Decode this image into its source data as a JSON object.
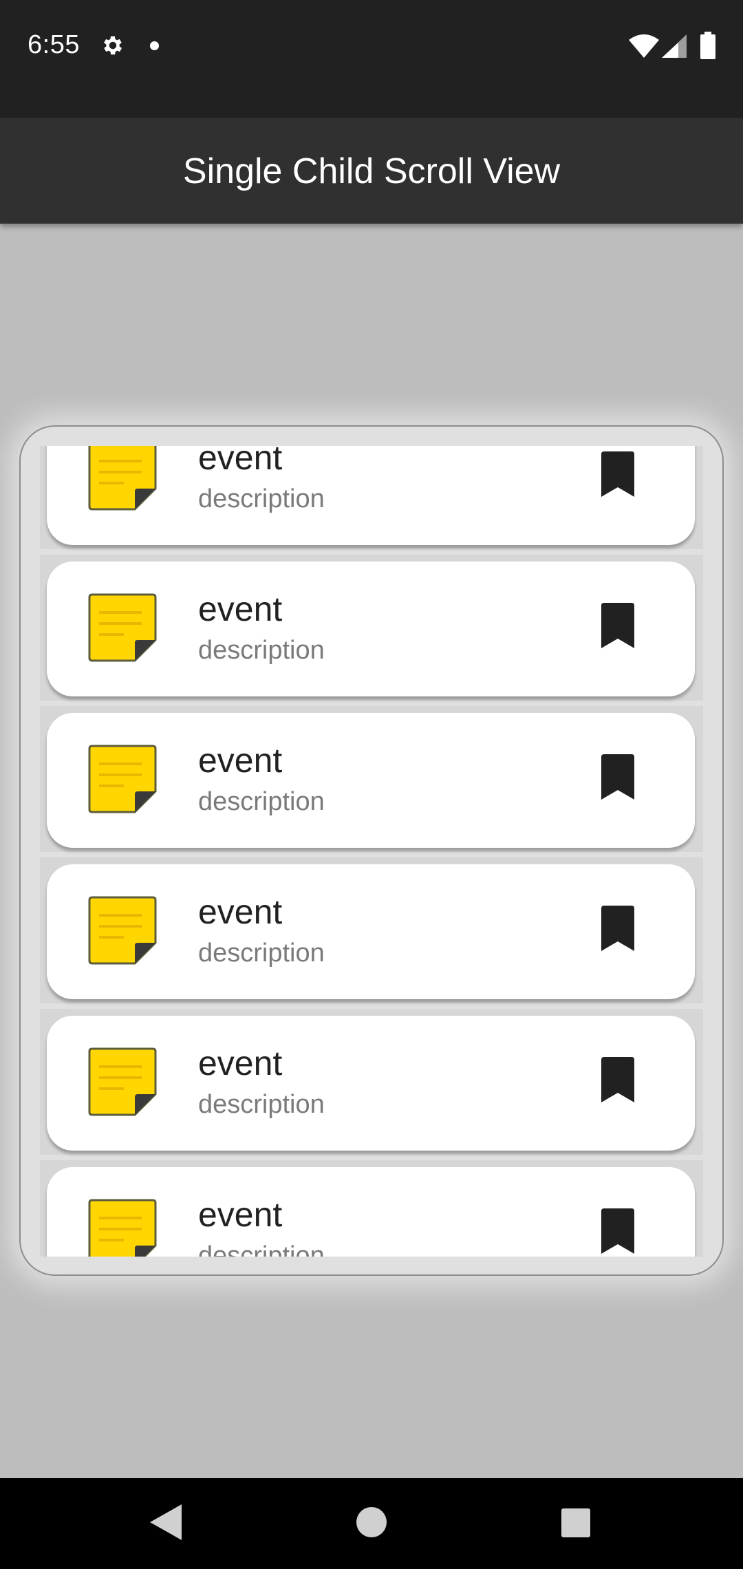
{
  "status_bar": {
    "time": "6:55",
    "icons": [
      "gear-icon",
      "dot-icon",
      "wifi-icon",
      "signal-icon",
      "battery-icon"
    ]
  },
  "app_bar": {
    "title": "Single Child Scroll View",
    "background": "#303030"
  },
  "list": {
    "items": [
      {
        "title": "event",
        "description": "description",
        "icon": "sticky-note-icon",
        "action_icon": "bookmark-icon"
      },
      {
        "title": "event",
        "description": "description",
        "icon": "sticky-note-icon",
        "action_icon": "bookmark-icon"
      },
      {
        "title": "event",
        "description": "description",
        "icon": "sticky-note-icon",
        "action_icon": "bookmark-icon"
      },
      {
        "title": "event",
        "description": "description",
        "icon": "sticky-note-icon",
        "action_icon": "bookmark-icon"
      },
      {
        "title": "event",
        "description": "description",
        "icon": "sticky-note-icon",
        "action_icon": "bookmark-icon"
      },
      {
        "title": "event",
        "description": "description",
        "icon": "sticky-note-icon",
        "action_icon": "bookmark-icon"
      }
    ]
  },
  "nav_bar": {
    "buttons": [
      "back-icon",
      "home-icon",
      "recents-icon"
    ]
  },
  "colors": {
    "page_background": "#bdbdbd",
    "status_bar": "#212121",
    "note_yellow": "#ffd600",
    "bookmark": "#212121"
  }
}
